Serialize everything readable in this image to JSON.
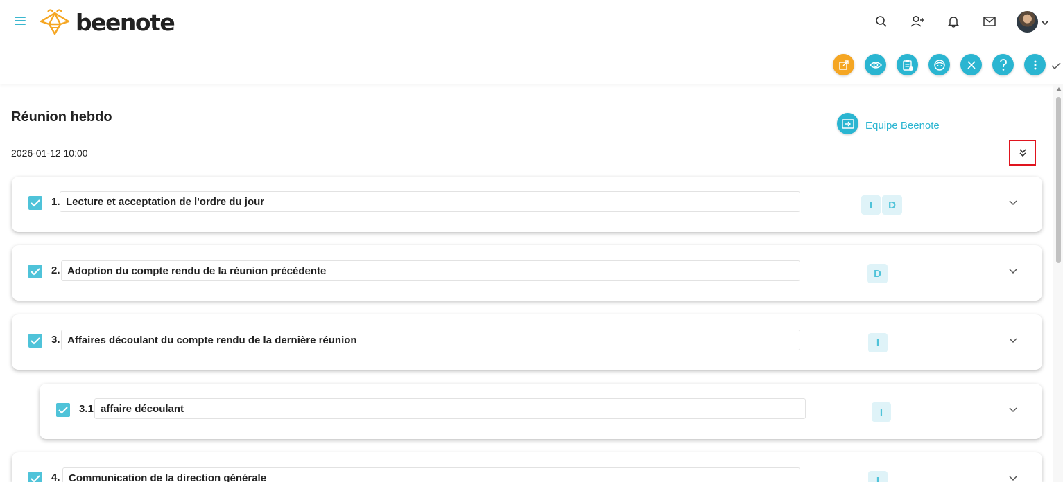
{
  "app": {
    "name": "beenote",
    "accent": "#2ab5d1",
    "accent_light": "#dff3f8",
    "orange": "#f5a623",
    "highlight": "#e0141e"
  },
  "header": {
    "icons": [
      "search-icon",
      "add-user-icon",
      "bell-icon",
      "mail-icon",
      "avatar",
      "chevron-down-icon"
    ]
  },
  "toolbar": {
    "buttons": [
      "share-icon",
      "eye-icon",
      "clipboard-icon",
      "face-icon",
      "close-icon",
      "help-icon",
      "more-vertical-icon"
    ],
    "trailing": "check-icon"
  },
  "meeting": {
    "title": "Réunion hebdo",
    "datetime": "2026-01-12 10:00",
    "team": "Equipe Beenote"
  },
  "agenda": [
    {
      "number": "1.",
      "title": "Lecture et acceptation de l'ordre du jour",
      "badges": [
        "I",
        "D"
      ],
      "checked": true
    },
    {
      "number": "2.",
      "title": "Adoption du compte rendu de la réunion précédente",
      "badges": [
        "D"
      ],
      "checked": true
    },
    {
      "number": "3.",
      "title": "Affaires découlant du compte rendu de la dernière réunion",
      "badges": [
        "I"
      ],
      "checked": true
    },
    {
      "number": "3.1.",
      "title": "affaire découlant",
      "badges": [
        "I"
      ],
      "checked": true
    },
    {
      "number": "4.",
      "title": "Communication de la direction générale",
      "badges": [
        "I"
      ],
      "checked": true
    }
  ]
}
